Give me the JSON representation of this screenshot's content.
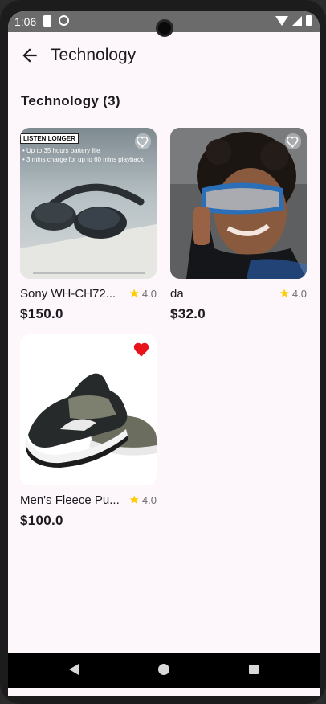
{
  "status_bar": {
    "time": "1:06"
  },
  "app_bar": {
    "title": "Technology",
    "back_icon": "arrow-left-icon"
  },
  "section": {
    "title": "Technology (3)"
  },
  "products": [
    {
      "name": "Sony WH-CH72...",
      "rating": "4.0",
      "price": "$150.0",
      "favorite": false,
      "image": "headphones",
      "ad": {
        "tag": "LISTEN LONGER",
        "lines": [
          "• Up to 35 hours battery life",
          "• 3 mins charge for up to 60 mins playback"
        ]
      }
    },
    {
      "name": "da",
      "rating": "4.0",
      "price": "$32.0",
      "favorite": false,
      "image": "vr-headset"
    },
    {
      "name": "Men's Fleece Pu...",
      "rating": "4.0",
      "price": "$100.0",
      "favorite": true,
      "image": "sneakers"
    }
  ],
  "colors": {
    "background": "#fdf7fc",
    "star": "#ffcc00",
    "favorite_active": "#e8141c",
    "favorite_inactive": "#ffffff",
    "text": "#1d1b20"
  },
  "nav_bar": {
    "back": "nav-back-icon",
    "home": "nav-home-icon",
    "recents": "nav-recents-icon"
  }
}
